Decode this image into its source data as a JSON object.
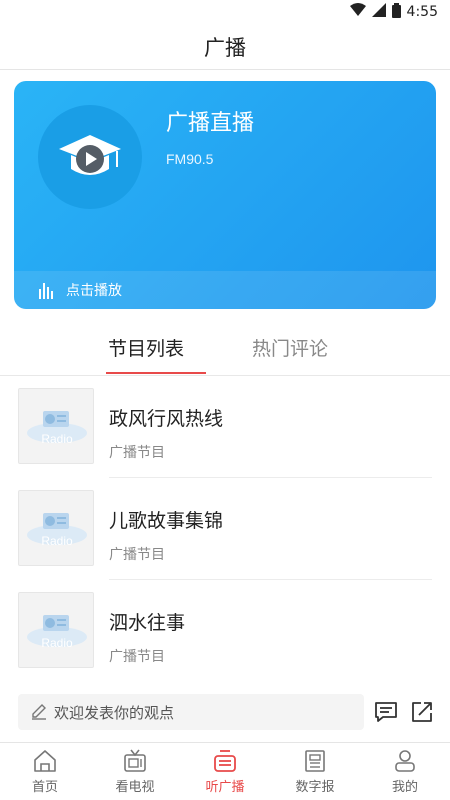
{
  "status": {
    "time": "4:55"
  },
  "header": {
    "title": "广播"
  },
  "live": {
    "title": "广播直播",
    "frequency": "FM90.5",
    "play_label": "点击播放"
  },
  "tabs": [
    {
      "label": "节目列表",
      "active": true
    },
    {
      "label": "热门评论",
      "active": false
    }
  ],
  "programs": [
    {
      "title": "政风行风热线",
      "subtitle": "广播节目",
      "thumb_text": "Radio"
    },
    {
      "title": "儿歌故事集锦",
      "subtitle": "广播节目",
      "thumb_text": "Radio"
    },
    {
      "title": "泗水往事",
      "subtitle": "广播节目",
      "thumb_text": "Radio"
    }
  ],
  "comment": {
    "placeholder": "欢迎发表你的观点"
  },
  "bottom_nav": [
    {
      "label": "首页",
      "icon": "home-icon",
      "active": false
    },
    {
      "label": "看电视",
      "icon": "tv-icon",
      "active": false
    },
    {
      "label": "听广播",
      "icon": "radio-icon",
      "active": true
    },
    {
      "label": "数字报",
      "icon": "newspaper-icon",
      "active": false
    },
    {
      "label": "我的",
      "icon": "user-icon",
      "active": false
    }
  ],
  "colors": {
    "accent": "#e84a4a",
    "card_blue": "#1e95ee"
  }
}
